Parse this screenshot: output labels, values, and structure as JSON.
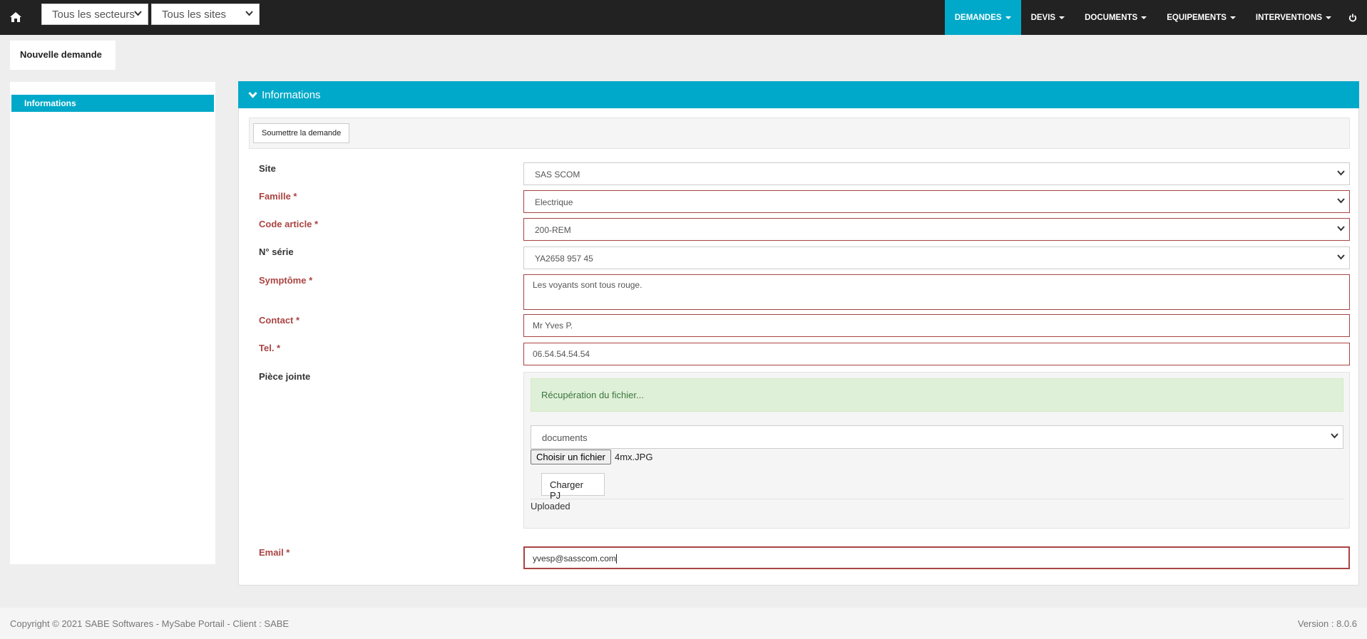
{
  "topbar": {
    "home_icon": "home-icon",
    "sector_select": "Tous les secteurs",
    "site_select": "Tous les sites",
    "nav": [
      {
        "label": "DEMANDES",
        "active": true
      },
      {
        "label": "DEVIS",
        "active": false
      },
      {
        "label": "DOCUMENTS",
        "active": false
      },
      {
        "label": "EQUIPEMENTS",
        "active": false
      },
      {
        "label": "INTERVENTIONS",
        "active": false
      }
    ],
    "power_icon": "power-icon"
  },
  "page_tab": "Nouvelle demande",
  "sidebar": {
    "items": [
      {
        "label": "Informations",
        "active": true
      }
    ]
  },
  "panel": {
    "title": "Informations",
    "submit_label": "Soumettre la demande"
  },
  "form": {
    "site": {
      "label": "Site",
      "value": "SAS SCOM"
    },
    "famille": {
      "label": "Famille *",
      "value": "Electrique"
    },
    "code_article": {
      "label": "Code article *",
      "value": "200-REM"
    },
    "serie": {
      "label": "N° série",
      "value": "YA2658 957 45"
    },
    "symptome": {
      "label": "Symptôme *",
      "value": "Les voyants sont tous rouge."
    },
    "contact": {
      "label": "Contact *",
      "value": "Mr Yves P."
    },
    "tel": {
      "label": "Tel. *",
      "value": "06.54.54.54.54"
    },
    "piece_jointe": {
      "label": "Pièce jointe",
      "status": "Récupération du fichier...",
      "category": "documents",
      "file_button": "Choisir un fichier",
      "file_name": "4mx.JPG",
      "upload_button": "Charger PJ",
      "upload_status": "Uploaded"
    },
    "email": {
      "label": "Email *",
      "value": "yvesp@sasscom.com"
    }
  },
  "footer": {
    "copyright": "Copyright © 2021 SABE Softwares - MySabe Portail - Client : SABE",
    "version": "Version : 8.0.6"
  },
  "colors": {
    "accent": "#00a9c9",
    "topbar": "#222222",
    "error": "#a94442",
    "success_bg": "#dff0d8"
  }
}
